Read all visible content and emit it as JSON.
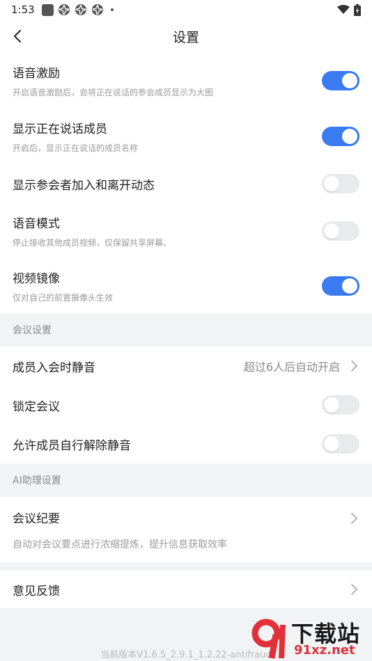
{
  "statusbar": {
    "time": "1:53"
  },
  "header": {
    "title": "设置"
  },
  "settings_top": [
    {
      "title": "语音激励",
      "subtitle": "开启语音激励后，会将正在说话的参会成员显示为大图",
      "on": true
    },
    {
      "title": "显示正在说话成员",
      "subtitle": "开启后，显示正在说话的成员名称",
      "on": true
    },
    {
      "title": "显示参会者加入和离开动态",
      "subtitle": "",
      "on": false
    },
    {
      "title": "语音模式",
      "subtitle": "停止接收其他成员视频，仅保留共享屏幕。",
      "on": false
    },
    {
      "title": "视频镜像",
      "subtitle": "仅对自己的前置摄像头生效",
      "on": true
    }
  ],
  "meeting_section": {
    "header": "会议设置",
    "mute_on_join": {
      "title": "成员入会时静音",
      "value": "超过6人后自动开启"
    },
    "lock_meeting": {
      "title": "锁定会议",
      "on": false
    },
    "allow_unmute": {
      "title": "允许成员自行解除静音",
      "on": false
    }
  },
  "ai_section": {
    "header": "AI助理设置",
    "summary": {
      "title": "会议纪要",
      "subtitle": "自动对会议要点进行浓缩提炼，提升信息获取效率"
    }
  },
  "feedback": {
    "title": "意见反馈"
  },
  "footer": {
    "version": "当前版本V1.6.5_2.9.1_1.2.22-antifraud"
  },
  "watermark": {
    "title": "下载站",
    "domain": "91xz.net"
  },
  "colors": {
    "accent": "#3a7bf2",
    "toggle_off": "#e9eaec",
    "page_bg": "#f2f3f5"
  }
}
